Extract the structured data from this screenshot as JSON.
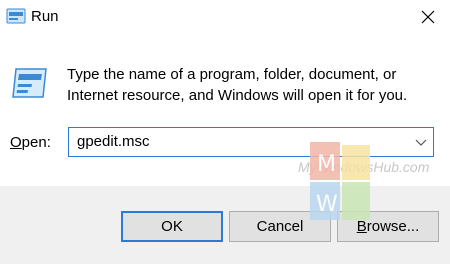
{
  "window": {
    "title": "Run",
    "close_icon": "close-icon"
  },
  "description": "Type the name of a program, folder, document, or Internet resource, and Windows will open it for you.",
  "open_field": {
    "label_prefix": "O",
    "label_rest": "pen:",
    "value": "gpedit.msc"
  },
  "buttons": {
    "ok": "OK",
    "cancel": "Cancel",
    "browse_prefix": "B",
    "browse_rest": "rowse..."
  },
  "watermark": {
    "text": "MyWindowsHub.com",
    "logo_letters": [
      "M",
      "W"
    ]
  },
  "colors": {
    "accent": "#2b7bd6",
    "footer_bg": "#f0f0f0"
  }
}
